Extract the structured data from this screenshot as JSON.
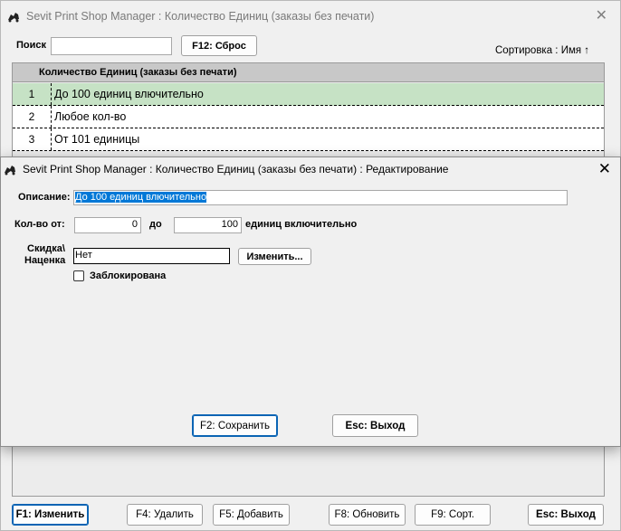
{
  "main_window": {
    "title": "Sevit Print Shop Manager : Количество Единиц (заказы без печати)",
    "search_label": "Поиск",
    "search_value": "",
    "reset_button": "F12: Сброс",
    "sort_label": "Сортировка : Имя ↑",
    "grid": {
      "header": "Количество Единиц (заказы без печати)",
      "rows": [
        {
          "num": "1",
          "name": "До 100 единиц влючительно"
        },
        {
          "num": "2",
          "name": "Любое кол-во"
        },
        {
          "num": "3",
          "name": "От 101 единицы"
        }
      ]
    },
    "footer_buttons": {
      "edit": "F1: Изменить",
      "delete": "F4: Удалить",
      "add": "F5: Добавить",
      "refresh": "F8: Обновить",
      "sort": "F9: Сорт.",
      "exit": "Esc: Выход"
    }
  },
  "edit_dialog": {
    "title": "Sevit Print Shop Manager : Количество Единиц (заказы без печати) : Редактирование",
    "description_label": "Описание:",
    "description_value": "До 100 единиц влючительно",
    "qty_from_label": "Кол-во от:",
    "qty_from_value": "0",
    "qty_to_label": "до",
    "qty_to_value": "100",
    "qty_suffix": "единиц включительно",
    "discount_label_1": "Скидка\\",
    "discount_label_2": "Наценка",
    "discount_value": "Нет",
    "change_button": "Изменить...",
    "blocked_label": "Заблокирована",
    "blocked_checked": false,
    "save_button": "F2: Сохранить",
    "exit_button": "Esc: Выход"
  },
  "colors": {
    "selected_row": "#c6e2c5",
    "grid_header": "#c8c8c8",
    "selection_highlight": "#0078d7",
    "focus_border": "#0a64b4"
  }
}
